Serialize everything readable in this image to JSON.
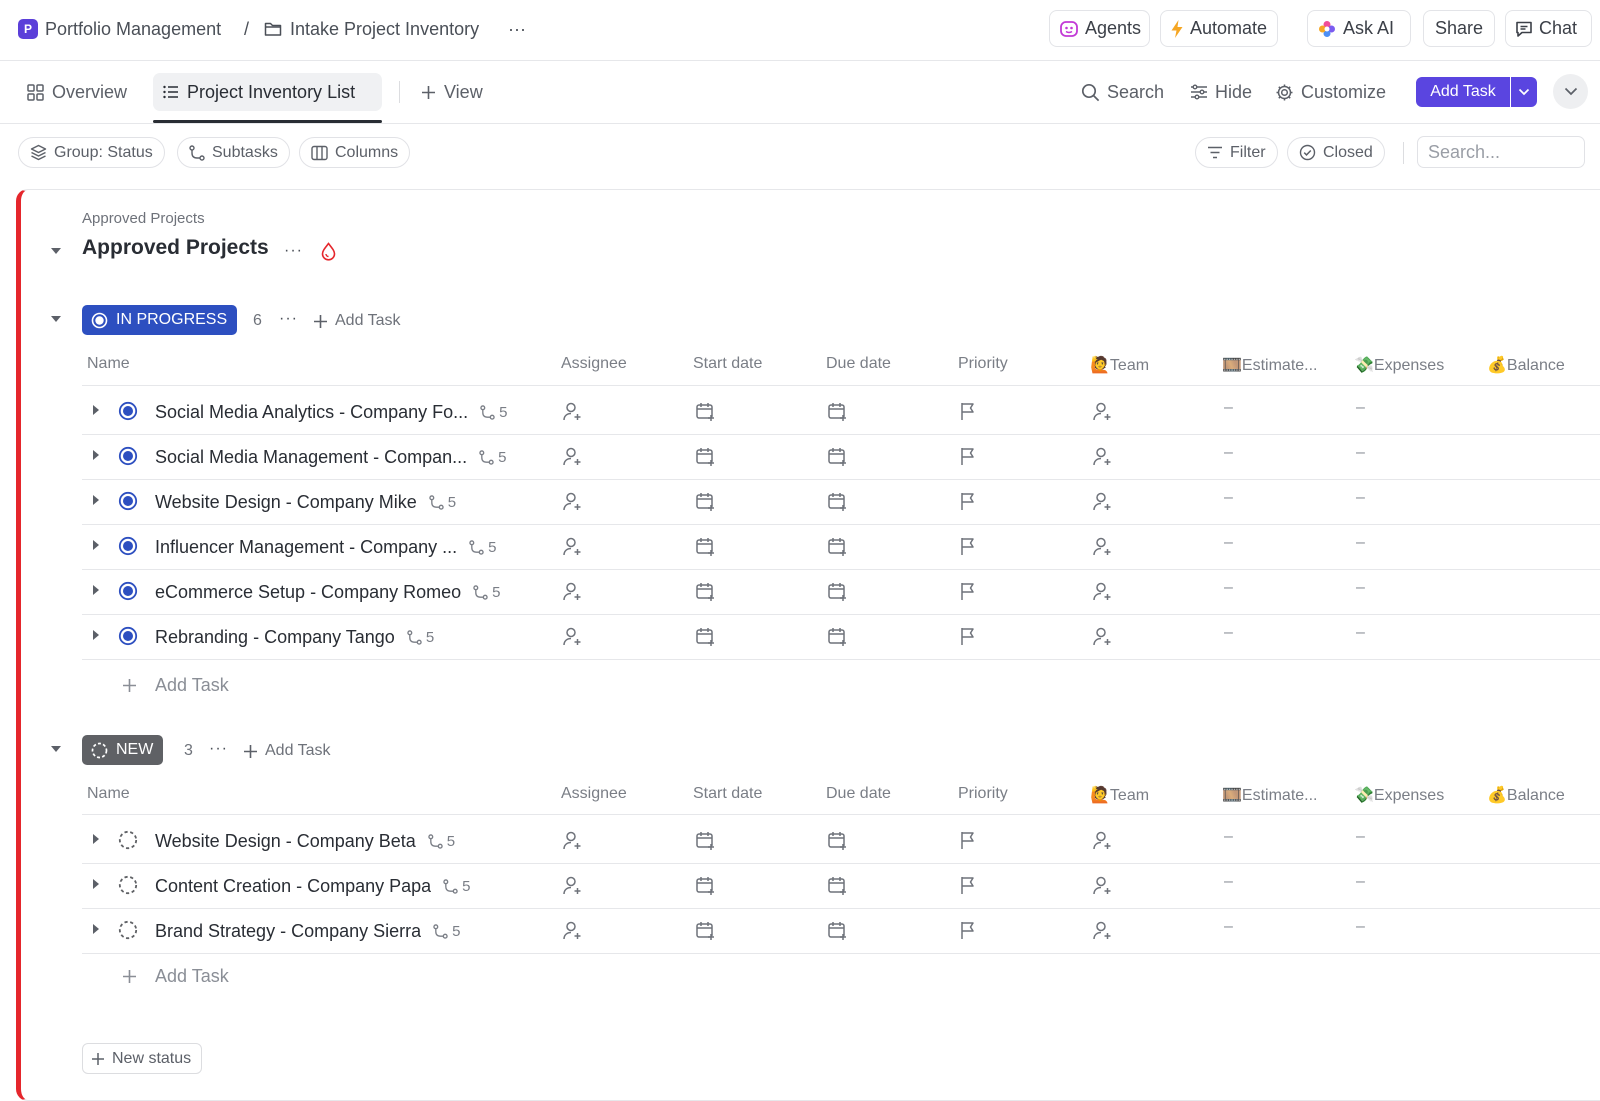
{
  "breadcrumb": {
    "space_initial": "P",
    "space_name": "Portfolio Management",
    "separator": "/",
    "list_name": "Intake Project Inventory",
    "more": "···"
  },
  "top_actions": {
    "agents": "Agents",
    "automate": "Automate",
    "ask_ai": "Ask AI",
    "share": "Share",
    "chat": "Chat"
  },
  "views": {
    "overview": "Overview",
    "list": "Project Inventory List",
    "add_view": "View",
    "search": "Search",
    "hide": "Hide",
    "customize": "Customize",
    "add_task": "Add Task"
  },
  "filters": {
    "group": "Group: Status",
    "subtasks": "Subtasks",
    "columns": "Columns",
    "filter": "Filter",
    "closed": "Closed",
    "search_placeholder": "Search..."
  },
  "folder": {
    "subtitle": "Approved Projects",
    "title": "Approved Projects",
    "more": "···"
  },
  "columns": {
    "name": "Name",
    "assignee": "Assignee",
    "start_date": "Start date",
    "due_date": "Due date",
    "priority": "Priority",
    "team": "🙋Team",
    "estimate": "🎞️Estimate...",
    "expenses": "💸Expenses",
    "balance": "💰Balance"
  },
  "groups": [
    {
      "status": "IN PROGRESS",
      "color": "#2d4fc0",
      "count": "6",
      "more": "···",
      "add_task": "Add Task",
      "add_task_row": "Add Task",
      "tasks": [
        {
          "name": "Social Media Analytics - Company Fo...",
          "subtasks": "5",
          "estimate": "–",
          "expenses": "–"
        },
        {
          "name": "Social Media Management - Compan...",
          "subtasks": "5",
          "estimate": "–",
          "expenses": "–"
        },
        {
          "name": "Website Design - Company Mike",
          "subtasks": "5",
          "estimate": "–",
          "expenses": "–"
        },
        {
          "name": "Influencer Management - Company ...",
          "subtasks": "5",
          "estimate": "–",
          "expenses": "–"
        },
        {
          "name": "eCommerce Setup - Company Romeo",
          "subtasks": "5",
          "estimate": "–",
          "expenses": "–"
        },
        {
          "name": "Rebranding - Company Tango",
          "subtasks": "5",
          "estimate": "–",
          "expenses": "–"
        }
      ]
    },
    {
      "status": "NEW",
      "color": "#5f6165",
      "count": "3",
      "more": "···",
      "add_task": "Add Task",
      "add_task_row": "Add Task",
      "tasks": [
        {
          "name": "Website Design - Company Beta",
          "subtasks": "5",
          "estimate": "–",
          "expenses": "–"
        },
        {
          "name": "Content Creation - Company Papa",
          "subtasks": "5",
          "estimate": "–",
          "expenses": "–"
        },
        {
          "name": "Brand Strategy - Company Sierra",
          "subtasks": "5",
          "estimate": "–",
          "expenses": "–"
        }
      ]
    }
  ],
  "new_status": "New status",
  "colors": {
    "accent": "#5a45e0",
    "folder_border": "#e5262c",
    "in_progress": "#2d4fc0",
    "new": "#5f6165"
  }
}
